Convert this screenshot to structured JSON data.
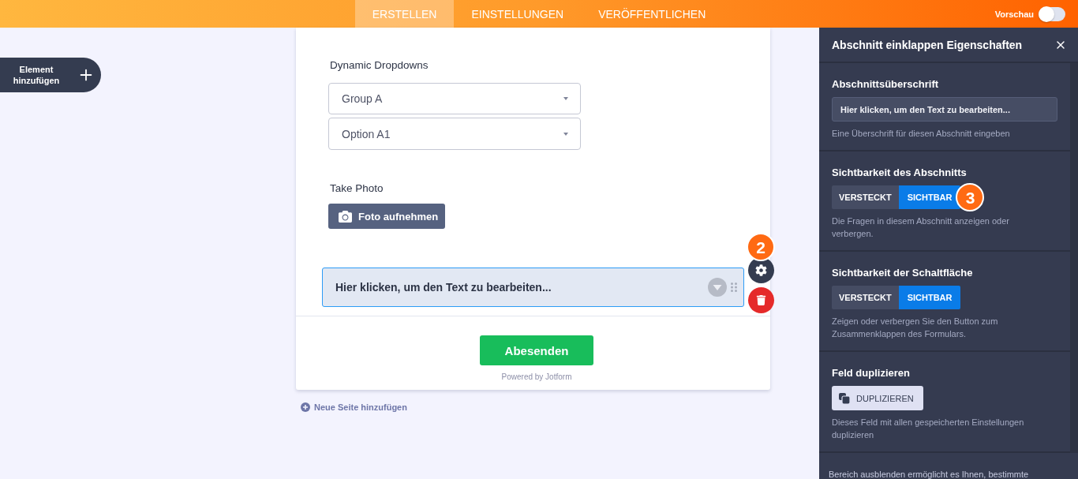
{
  "top_bar": {
    "tabs": [
      {
        "label": "ERSTELLEN",
        "selected": true
      },
      {
        "label": "EINSTELLUNGEN",
        "selected": false
      },
      {
        "label": "VERÖFFENTLICHEN",
        "selected": false
      }
    ],
    "preview": {
      "label": "Vorschau",
      "on": false
    }
  },
  "add_element_button": {
    "label": "Element hinzufügen"
  },
  "form": {
    "fields": [
      {
        "kind": "dropdowns",
        "label": "Dynamic Dropdowns",
        "dropdowns": [
          "Group A",
          "Option A1"
        ]
      },
      {
        "kind": "photo",
        "label": "Take Photo",
        "button": "Foto aufnehmen"
      },
      {
        "kind": "collapse",
        "text": "Hier klicken, um den Text zu bearbeiten...",
        "selected": true,
        "badge": "2"
      }
    ],
    "submit_button": "Abesenden",
    "powered_by": "Powered by Jotform"
  },
  "add_page_link": "Neue Seite hinzufügen",
  "properties_panel": {
    "title": "Abschnitt einklappen Eigenschaften",
    "sections": [
      {
        "kind": "text_input",
        "label": "Abschnittsüberschrift",
        "value": "Hier klicken, um den Text zu bearbeiten...",
        "hint": "Eine Überschrift für diesen Abschnitt eingeben"
      },
      {
        "kind": "toggle",
        "label": "Sichtbarkeit des Abschnitts",
        "options": [
          {
            "label": "VERSTECKT",
            "selected": false
          },
          {
            "label": "SICHTBAR",
            "selected": true
          }
        ],
        "badge": "3",
        "hint": "Die Fragen in diesem Abschnitt anzeigen oder verbergen."
      },
      {
        "kind": "toggle",
        "label": "Sichtbarkeit der Schaltfläche",
        "options": [
          {
            "label": "VERSTECKT",
            "selected": false
          },
          {
            "label": "SICHTBAR",
            "selected": true
          }
        ],
        "hint": "Zeigen oder verbergen Sie den Button zum Zusammenklappen des Formulars."
      },
      {
        "kind": "button",
        "label": "Feld duplizieren",
        "button": "DUPLIZIEREN",
        "hint": "Dieses Feld mit allen gespeicherten Einstellungen duplizieren"
      }
    ],
    "footer_note": "Bereich ausblenden ermöglicht es Ihnen, bestimmte"
  }
}
